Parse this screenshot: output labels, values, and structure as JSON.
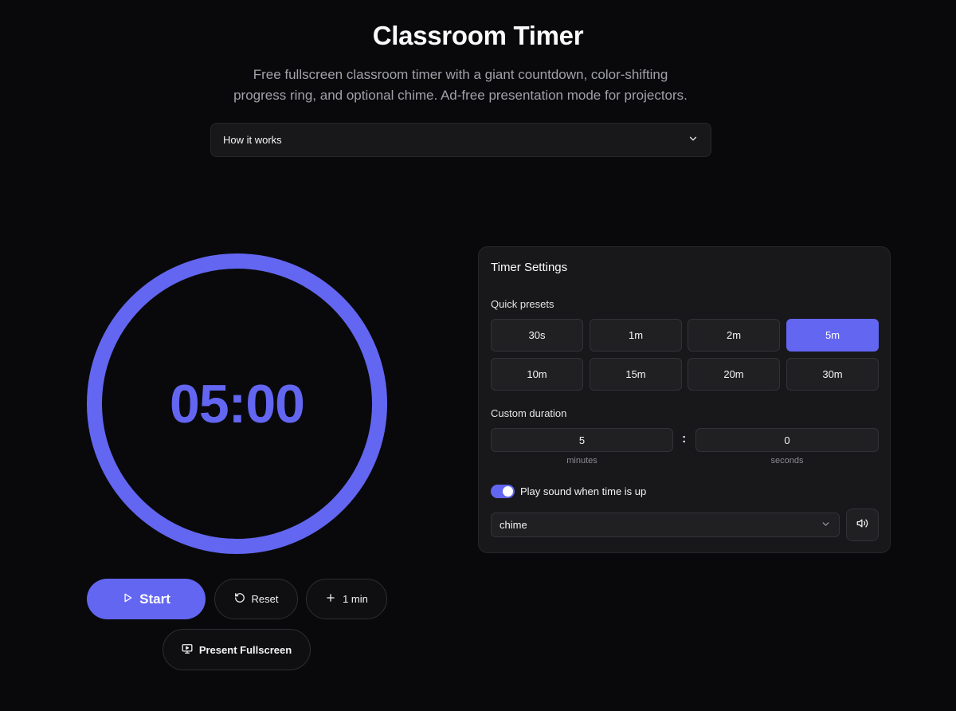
{
  "header": {
    "title": "Classroom Timer",
    "subtitle_line1": "Free fullscreen classroom timer with a giant countdown, color-shifting",
    "subtitle_line2": "progress ring, and optional chime. Ad-free presentation mode for projectors.",
    "how_it_works": "How it works"
  },
  "timer": {
    "display": "05:00",
    "progress": 1.0,
    "ring_color": "#6366f1"
  },
  "controls": {
    "start": "Start",
    "reset": "Reset",
    "add_minute": "1 min",
    "present": "Present Fullscreen"
  },
  "settings": {
    "title": "Timer Settings",
    "quick_presets_label": "Quick presets",
    "presets": [
      "30s",
      "1m",
      "2m",
      "5m",
      "10m",
      "15m",
      "20m",
      "30m"
    ],
    "active_preset": "5m",
    "custom_label": "Custom duration",
    "minutes_value": "5",
    "seconds_value": "0",
    "minutes_label": "minutes",
    "seconds_label": "seconds",
    "separator": ":",
    "sound_enabled": true,
    "sound_label": "Play sound when time is up",
    "sound_choice": "chime"
  },
  "colors": {
    "accent": "#6366f1",
    "background": "#09090b",
    "panel": "#18181b"
  },
  "icons": {
    "accordion": "chevron-down-icon",
    "start": "play-icon",
    "reset": "rotate-ccw-icon",
    "add": "plus-icon",
    "present": "monitor-icon",
    "select": "chevron-down-icon",
    "preview": "volume-icon"
  }
}
